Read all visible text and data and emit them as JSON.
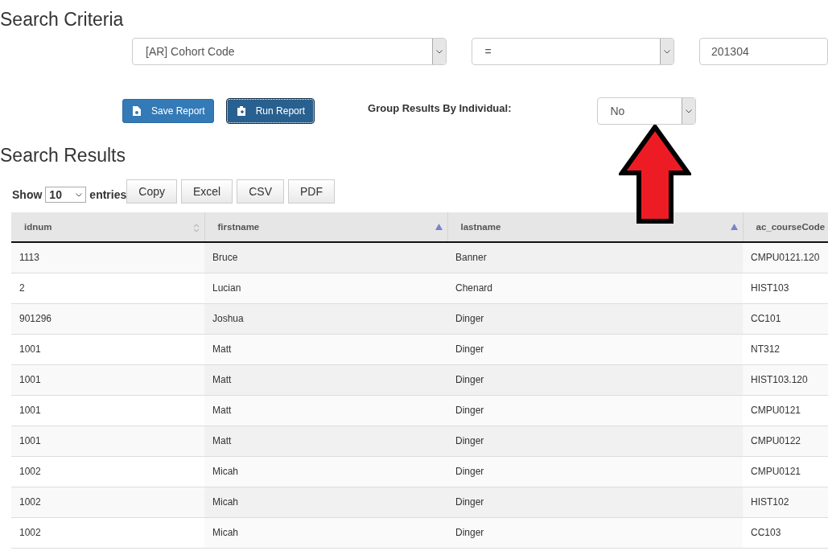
{
  "criteria": {
    "title": "Search Criteria",
    "field": "[AR] Cohort Code",
    "operator": "=",
    "value": "201304"
  },
  "actions": {
    "save": "Save Report",
    "run": "Run Report",
    "group_label": "Group Results By Individual:",
    "group_value": "No"
  },
  "results": {
    "title": "Search Results",
    "show_label": "Show",
    "page_size": "10",
    "entries_label": "entries",
    "export_buttons": [
      "Copy",
      "Excel",
      "CSV",
      "PDF"
    ],
    "columns": [
      {
        "label": "idnum",
        "sorted": false
      },
      {
        "label": "firstname",
        "sorted": true
      },
      {
        "label": "lastname",
        "sorted": true
      },
      {
        "label": "ac_courseCode"
      }
    ],
    "rows": [
      [
        "1113",
        "Bruce",
        "Banner",
        "CMPU0121.120"
      ],
      [
        "2",
        "Lucian",
        "Chenard",
        "HIST103"
      ],
      [
        "901296",
        "Joshua",
        "Dinger",
        "CC101"
      ],
      [
        "1001",
        "Matt",
        "Dinger",
        "NT312"
      ],
      [
        "1001",
        "Matt",
        "Dinger",
        "HIST103.120"
      ],
      [
        "1001",
        "Matt",
        "Dinger",
        "CMPU0121"
      ],
      [
        "1001",
        "Matt",
        "Dinger",
        "CMPU0122"
      ],
      [
        "1002",
        "Micah",
        "Dinger",
        "CMPU0121"
      ],
      [
        "1002",
        "Micah",
        "Dinger",
        "HIST102"
      ],
      [
        "1002",
        "Micah",
        "Dinger",
        "CC103"
      ]
    ]
  }
}
